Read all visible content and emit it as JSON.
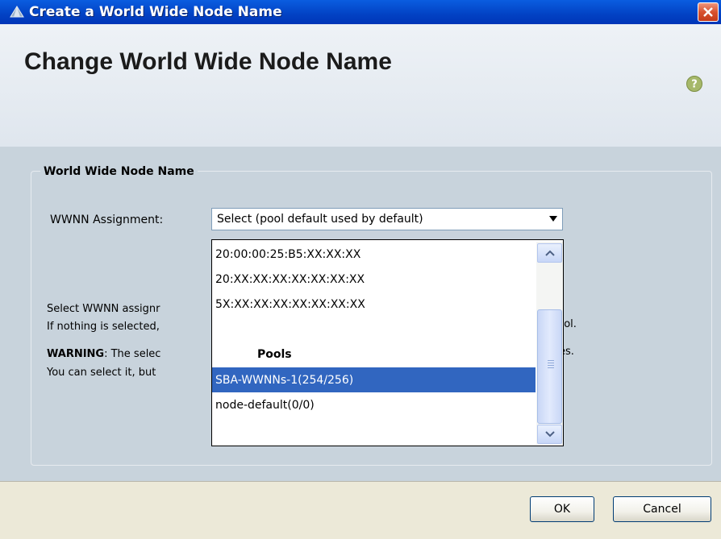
{
  "window": {
    "title": "Create a World Wide Node Name",
    "icons": {
      "app": "pyramid-icon",
      "close": "close-icon",
      "help": "help-icon"
    }
  },
  "header": {
    "title": "Change World Wide Node Name"
  },
  "group": {
    "title": "World Wide Node Name",
    "field_label": "WWNN Assignment:",
    "select_value": "Select (pool default used by default)",
    "help_lines": {
      "line1": "Select WWNN assignr",
      "line2_left": "If nothing is selected,",
      "line2_right": "pool.",
      "line3_bold": "WARNING",
      "line3_left": ": The selec",
      "line3_right": "es.",
      "line4_left": "You can select it, but"
    }
  },
  "dropdown": {
    "items": [
      "20:00:00:25:B5:XX:XX:XX",
      "20:XX:XX:XX:XX:XX:XX:XX",
      "5X:XX:XX:XX:XX:XX:XX:XX"
    ],
    "group_header": "Pools",
    "pools": [
      {
        "label": "SBA-WWNNs-1(254/256)",
        "selected": true
      },
      {
        "label": "node-default(0/0)",
        "selected": false
      }
    ]
  },
  "footer": {
    "ok_label": "OK",
    "cancel_label": "Cancel"
  },
  "colors": {
    "titlebar": "#0242c4",
    "selection": "#3166c0",
    "panel": "#c8d3dc"
  }
}
